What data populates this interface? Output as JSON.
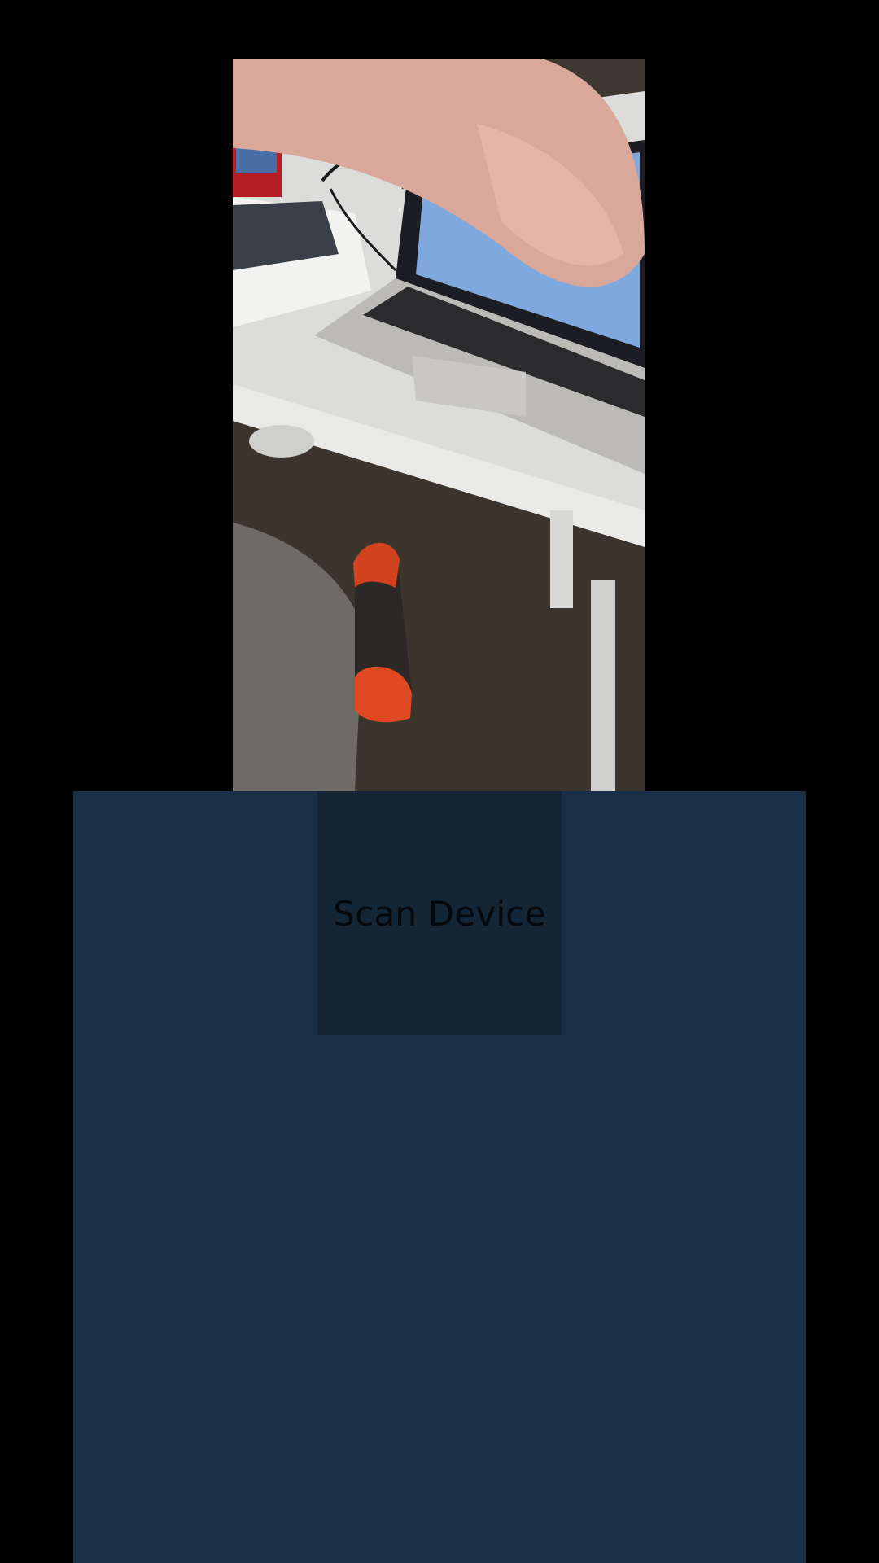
{
  "camera": {
    "icon": "camera-feed",
    "description_label": ""
  },
  "scan_button": {
    "label": "Scan Device"
  },
  "colors": {
    "background": "#000000",
    "panel": "#182f45",
    "button": "#142536",
    "button_text": "#05090d"
  }
}
